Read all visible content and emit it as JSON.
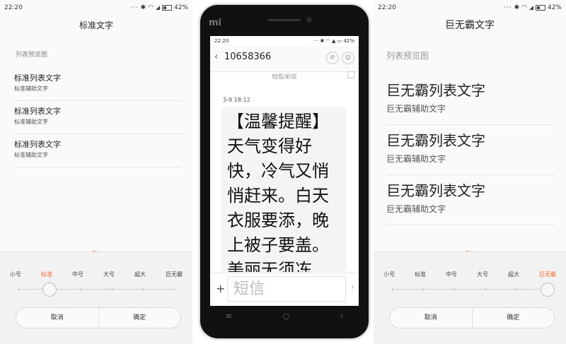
{
  "left": {
    "status": {
      "time": "22:20",
      "battery": "42%"
    },
    "title": "标准文字",
    "section_label": "列表预览图",
    "items": [
      {
        "primary": "标准列表文字",
        "secondary": "标准辅助文字"
      },
      {
        "primary": "标准列表文字",
        "secondary": "标准辅助文字"
      },
      {
        "primary": "标准列表文字",
        "secondary": "标准辅助文字"
      }
    ],
    "sizes": [
      "小号",
      "标准",
      "中号",
      "大号",
      "超大",
      "巨无霸"
    ],
    "selected_size": "标准",
    "cancel": "取消",
    "confirm": "确定"
  },
  "phone": {
    "logo": "mi",
    "status": {
      "time": "22:20",
      "battery": "42%"
    },
    "contact_number": "10658366",
    "conversation_label": "短信/彩信",
    "message_time": "3-9 18:12",
    "message_text": "【温馨提醒】天气变得好快，冷气又悄悄赶来。白天衣服要添，晚上被子要盖。美丽无须冻",
    "input_placeholder": "短信",
    "nav": {
      "menu": "≡",
      "home": "○",
      "back": "‹"
    }
  },
  "right": {
    "status": {
      "time": "22:20",
      "battery": "42%"
    },
    "title": "巨无霸文字",
    "section_label": "列表预览图",
    "items": [
      {
        "primary": "巨无霸列表文字",
        "secondary": "巨无霸辅助文字"
      },
      {
        "primary": "巨无霸列表文字",
        "secondary": "巨无霸辅助文字"
      },
      {
        "primary": "巨无霸列表文字",
        "secondary": "巨无霸辅助文字"
      }
    ],
    "sizes": [
      "小号",
      "标准",
      "中号",
      "大号",
      "超大",
      "巨无霸"
    ],
    "selected_size": "巨无霸",
    "cancel": "取消",
    "confirm": "确定"
  },
  "colors": {
    "accent": "#ff6a2b",
    "background": "#fafafa"
  },
  "icons": [
    "bluetooth-icon",
    "wifi-icon",
    "signal-icon",
    "battery-icon",
    "phone-icon",
    "contact-icon",
    "back-arrow-icon",
    "plus-icon",
    "send-icon"
  ]
}
